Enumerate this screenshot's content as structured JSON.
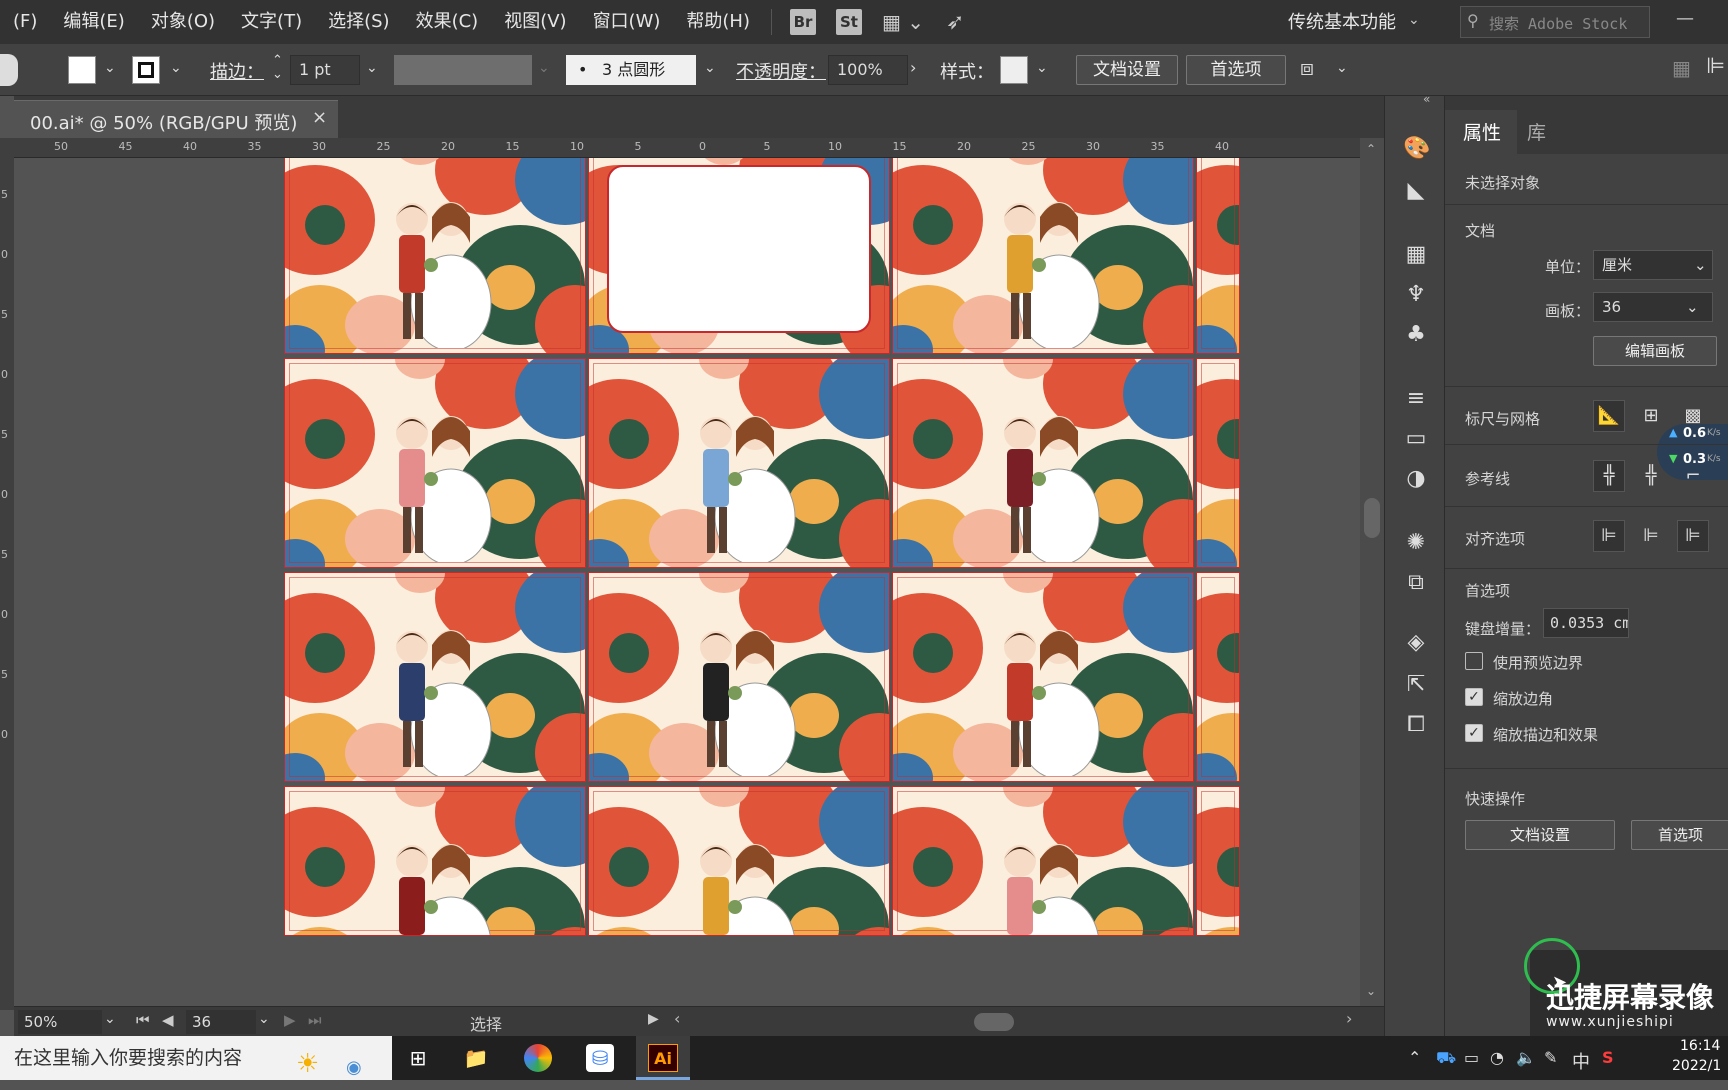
{
  "menubar": {
    "items": [
      "(F)",
      "编辑(E)",
      "对象(O)",
      "文字(T)",
      "选择(S)",
      "效果(C)",
      "视图(V)",
      "窗口(W)",
      "帮助(H)"
    ],
    "bridge_label": "Br",
    "stock_label": "St",
    "workspace": "传统基本功能",
    "search_placeholder": "搜索 Adobe Stock"
  },
  "control_bar": {
    "stroke_label": "描边：",
    "stroke_weight": "1 pt",
    "brush_label": "3 点圆形",
    "brush_dot": "•",
    "opacity_label": "不透明度：",
    "opacity_value": "100%",
    "style_label": "样式：",
    "doc_setup_button": "文档设置",
    "preferences_button": "首选项"
  },
  "document": {
    "tab_title": "00.ai* @ 50% (RGB/GPU 预览)",
    "close": "×"
  },
  "rulers": {
    "horizontal": [
      "50",
      "45",
      "40",
      "35",
      "30",
      "25",
      "20",
      "15",
      "10",
      "5",
      "0",
      "5",
      "10",
      "15",
      "20",
      "25",
      "30",
      "35",
      "40"
    ],
    "vertical": [
      "5",
      "0",
      "5",
      "0",
      "5",
      "0",
      "5",
      "0",
      "5",
      "0"
    ]
  },
  "status_bar": {
    "zoom": "50%",
    "artboard": "36",
    "tool": "选择"
  },
  "panel": {
    "tabs": [
      "属性",
      "库"
    ],
    "no_selection": "未选择对象",
    "document_section": "文档",
    "units_label": "单位：",
    "units_value": "厘米",
    "artboard_label": "画板：",
    "artboard_value": "36",
    "edit_artboards": "编辑画板",
    "rulers_grid": "标尺与网格",
    "guides": "参考线",
    "align_options": "对齐选项",
    "preferences_section": "首选项",
    "keyboard_increment_label": "键盘增量：",
    "keyboard_increment_value": "0.0353 cm",
    "use_preview_bounds": "使用预览边界",
    "use_preview_bounds_checked": false,
    "scale_corners": "缩放边角",
    "scale_corners_checked": true,
    "scale_strokes": "缩放描边和效果",
    "scale_strokes_checked": true,
    "quick_actions": "快速操作",
    "doc_setup_button": "文档设置",
    "preferences_button": "首选项",
    "net_up": "0.6",
    "net_down": "0.3",
    "net_unit": "K/s"
  },
  "taskbar": {
    "search_placeholder": "在这里输入你要搜索的内容",
    "ai_label": "Ai",
    "ime": "中",
    "time": "16:14",
    "date": "2022/1"
  },
  "watermark": {
    "title": "迅捷屏幕录像",
    "url": "www.xunjieshipi"
  },
  "colors": {
    "artboard_border": "#c8282b",
    "flower_orange": "#e0553a",
    "flower_blue": "#3c73a6",
    "flower_green": "#2e5a44",
    "flower_yellow": "#f0ad4e",
    "flower_pink": "#f4b69c",
    "ui_dark": "#323232",
    "ui_mid": "#424242"
  }
}
